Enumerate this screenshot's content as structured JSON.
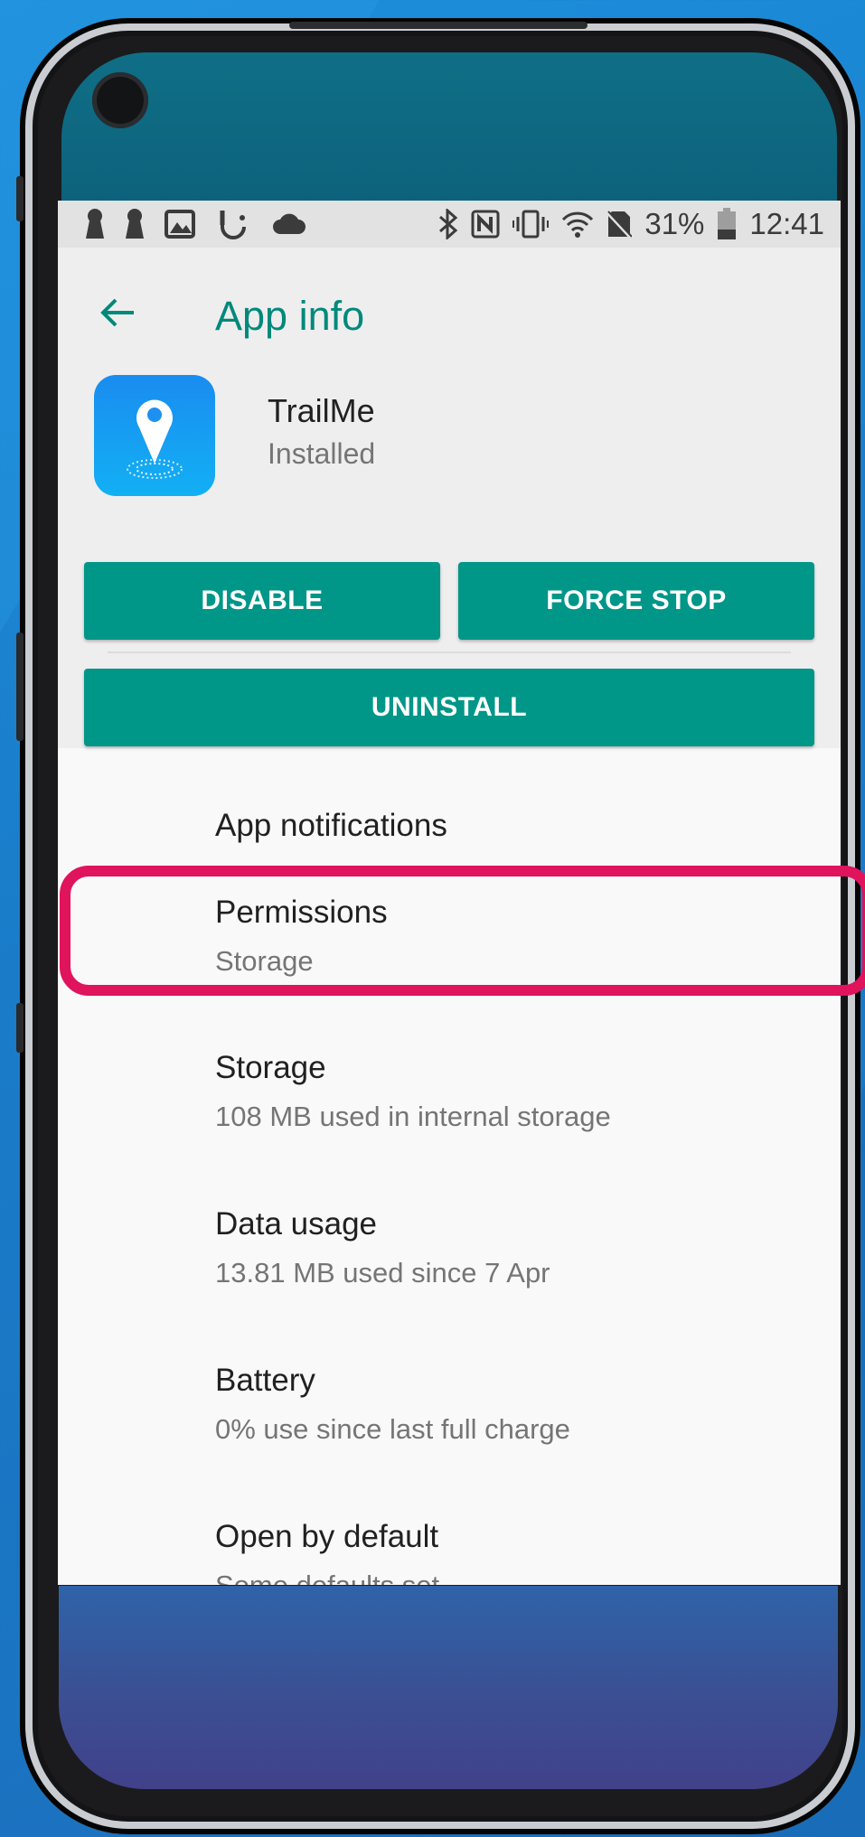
{
  "status_bar": {
    "battery_percent": "31%",
    "time": "12:41",
    "left_icons": [
      "keyhole-icon",
      "keyhole-icon",
      "image-icon",
      "touch-icon",
      "cloud-icon"
    ],
    "right_icons": [
      "bluetooth-icon",
      "nfc-icon",
      "vibrate-icon",
      "wifi-icon",
      "no-sim-icon",
      "battery-icon"
    ]
  },
  "app_bar": {
    "title": "App info",
    "back_icon": "arrow-left-icon",
    "accent_color": "#00897b"
  },
  "app": {
    "name": "TrailMe",
    "status": "Installed",
    "icon": "location-pin-icon"
  },
  "buttons": {
    "disable": "DISABLE",
    "force_stop": "FORCE STOP",
    "uninstall": "UNINSTALL",
    "color": "#009688"
  },
  "settings_list": [
    {
      "title": "App notifications",
      "subtitle": ""
    },
    {
      "title": "Permissions",
      "subtitle": "Storage"
    },
    {
      "title": "Storage",
      "subtitle": "108 MB used in internal storage"
    },
    {
      "title": "Data usage",
      "subtitle": "13.81 MB used since 7 Apr"
    },
    {
      "title": "Battery",
      "subtitle": "0% use since last full charge"
    },
    {
      "title": "Open by default",
      "subtitle": "Some defaults set"
    }
  ],
  "highlight_color": "#e0135d"
}
